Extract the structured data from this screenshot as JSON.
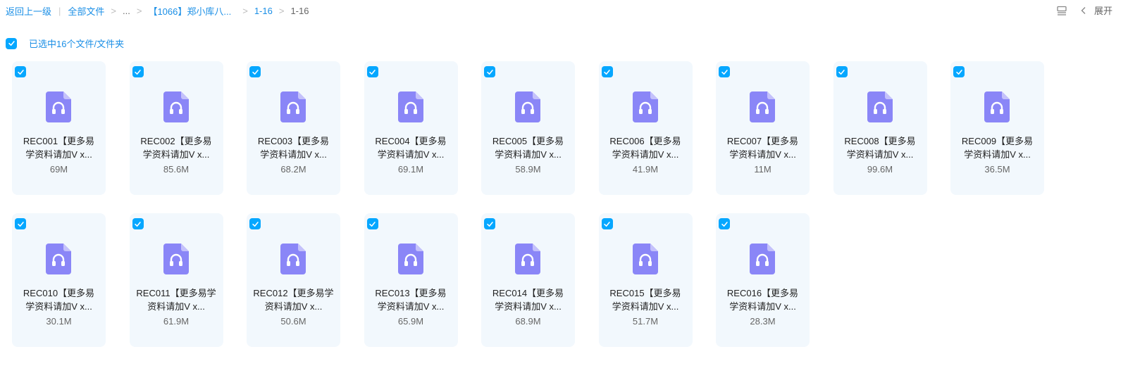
{
  "breadcrumb": {
    "back": "返回上一级",
    "all_files": "全部文件",
    "ellipsis": "...",
    "folder1": "【1066】郑小库八...",
    "folder2": "1-16",
    "current": "1-16",
    "separator": ">",
    "bar": "|"
  },
  "toolbar": {
    "expand_label": "展开"
  },
  "selection": {
    "label": "已选中16个文件/文件夹"
  },
  "colors": {
    "accent": "#06a7ff",
    "link": "#1b8fe6",
    "card_bg": "#f2f8fd",
    "icon": "#8a86f7"
  },
  "files": [
    {
      "line1": "REC001【更多易",
      "line2": "学资料请加V x...",
      "size": "69M"
    },
    {
      "line1": "REC002【更多易",
      "line2": "学资料请加V x...",
      "size": "85.6M"
    },
    {
      "line1": "REC003【更多易",
      "line2": "学资料请加V x...",
      "size": "68.2M"
    },
    {
      "line1": "REC004【更多易",
      "line2": "学资料请加V x...",
      "size": "69.1M"
    },
    {
      "line1": "REC005【更多易",
      "line2": "学资料请加V x...",
      "size": "58.9M"
    },
    {
      "line1": "REC006【更多易",
      "line2": "学资料请加V x...",
      "size": "41.9M"
    },
    {
      "line1": "REC007【更多易",
      "line2": "学资料请加V x...",
      "size": "11M"
    },
    {
      "line1": "REC008【更多易",
      "line2": "学资料请加V x...",
      "size": "99.6M"
    },
    {
      "line1": "REC009【更多易",
      "line2": "学资料请加V x...",
      "size": "36.5M"
    },
    {
      "line1": "REC010【更多易",
      "line2": "学资料请加V x...",
      "size": "30.1M"
    },
    {
      "line1": "REC011【更多易学",
      "line2": "资料请加V x...",
      "size": "61.9M"
    },
    {
      "line1": "REC012【更多易学",
      "line2": "资料请加V x...",
      "size": "50.6M"
    },
    {
      "line1": "REC013【更多易",
      "line2": "学资料请加V x...",
      "size": "65.9M"
    },
    {
      "line1": "REC014【更多易",
      "line2": "学资料请加V x...",
      "size": "68.9M"
    },
    {
      "line1": "REC015【更多易",
      "line2": "学资料请加V x...",
      "size": "51.7M"
    },
    {
      "line1": "REC016【更多易",
      "line2": "学资料请加V x...",
      "size": "28.3M"
    }
  ]
}
